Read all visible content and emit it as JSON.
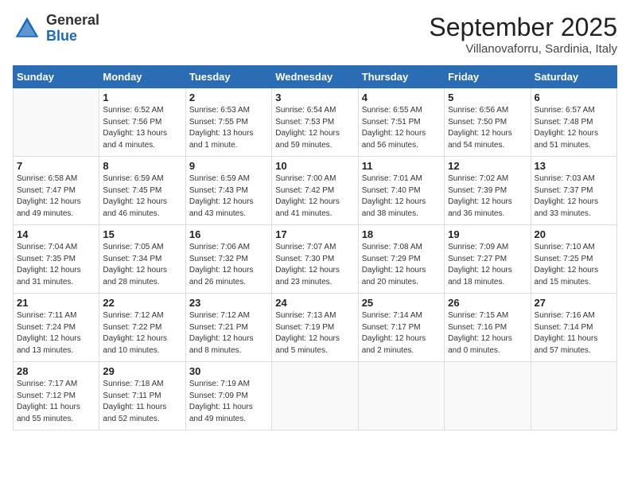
{
  "logo": {
    "general": "General",
    "blue": "Blue"
  },
  "title": "September 2025",
  "subtitle": "Villanovaforru, Sardinia, Italy",
  "days_of_week": [
    "Sunday",
    "Monday",
    "Tuesday",
    "Wednesday",
    "Thursday",
    "Friday",
    "Saturday"
  ],
  "weeks": [
    [
      {
        "day": "",
        "info": ""
      },
      {
        "day": "1",
        "info": "Sunrise: 6:52 AM\nSunset: 7:56 PM\nDaylight: 13 hours\nand 4 minutes."
      },
      {
        "day": "2",
        "info": "Sunrise: 6:53 AM\nSunset: 7:55 PM\nDaylight: 13 hours\nand 1 minute."
      },
      {
        "day": "3",
        "info": "Sunrise: 6:54 AM\nSunset: 7:53 PM\nDaylight: 12 hours\nand 59 minutes."
      },
      {
        "day": "4",
        "info": "Sunrise: 6:55 AM\nSunset: 7:51 PM\nDaylight: 12 hours\nand 56 minutes."
      },
      {
        "day": "5",
        "info": "Sunrise: 6:56 AM\nSunset: 7:50 PM\nDaylight: 12 hours\nand 54 minutes."
      },
      {
        "day": "6",
        "info": "Sunrise: 6:57 AM\nSunset: 7:48 PM\nDaylight: 12 hours\nand 51 minutes."
      }
    ],
    [
      {
        "day": "7",
        "info": "Sunrise: 6:58 AM\nSunset: 7:47 PM\nDaylight: 12 hours\nand 49 minutes."
      },
      {
        "day": "8",
        "info": "Sunrise: 6:59 AM\nSunset: 7:45 PM\nDaylight: 12 hours\nand 46 minutes."
      },
      {
        "day": "9",
        "info": "Sunrise: 6:59 AM\nSunset: 7:43 PM\nDaylight: 12 hours\nand 43 minutes."
      },
      {
        "day": "10",
        "info": "Sunrise: 7:00 AM\nSunset: 7:42 PM\nDaylight: 12 hours\nand 41 minutes."
      },
      {
        "day": "11",
        "info": "Sunrise: 7:01 AM\nSunset: 7:40 PM\nDaylight: 12 hours\nand 38 minutes."
      },
      {
        "day": "12",
        "info": "Sunrise: 7:02 AM\nSunset: 7:39 PM\nDaylight: 12 hours\nand 36 minutes."
      },
      {
        "day": "13",
        "info": "Sunrise: 7:03 AM\nSunset: 7:37 PM\nDaylight: 12 hours\nand 33 minutes."
      }
    ],
    [
      {
        "day": "14",
        "info": "Sunrise: 7:04 AM\nSunset: 7:35 PM\nDaylight: 12 hours\nand 31 minutes."
      },
      {
        "day": "15",
        "info": "Sunrise: 7:05 AM\nSunset: 7:34 PM\nDaylight: 12 hours\nand 28 minutes."
      },
      {
        "day": "16",
        "info": "Sunrise: 7:06 AM\nSunset: 7:32 PM\nDaylight: 12 hours\nand 26 minutes."
      },
      {
        "day": "17",
        "info": "Sunrise: 7:07 AM\nSunset: 7:30 PM\nDaylight: 12 hours\nand 23 minutes."
      },
      {
        "day": "18",
        "info": "Sunrise: 7:08 AM\nSunset: 7:29 PM\nDaylight: 12 hours\nand 20 minutes."
      },
      {
        "day": "19",
        "info": "Sunrise: 7:09 AM\nSunset: 7:27 PM\nDaylight: 12 hours\nand 18 minutes."
      },
      {
        "day": "20",
        "info": "Sunrise: 7:10 AM\nSunset: 7:25 PM\nDaylight: 12 hours\nand 15 minutes."
      }
    ],
    [
      {
        "day": "21",
        "info": "Sunrise: 7:11 AM\nSunset: 7:24 PM\nDaylight: 12 hours\nand 13 minutes."
      },
      {
        "day": "22",
        "info": "Sunrise: 7:12 AM\nSunset: 7:22 PM\nDaylight: 12 hours\nand 10 minutes."
      },
      {
        "day": "23",
        "info": "Sunrise: 7:12 AM\nSunset: 7:21 PM\nDaylight: 12 hours\nand 8 minutes."
      },
      {
        "day": "24",
        "info": "Sunrise: 7:13 AM\nSunset: 7:19 PM\nDaylight: 12 hours\nand 5 minutes."
      },
      {
        "day": "25",
        "info": "Sunrise: 7:14 AM\nSunset: 7:17 PM\nDaylight: 12 hours\nand 2 minutes."
      },
      {
        "day": "26",
        "info": "Sunrise: 7:15 AM\nSunset: 7:16 PM\nDaylight: 12 hours\nand 0 minutes."
      },
      {
        "day": "27",
        "info": "Sunrise: 7:16 AM\nSunset: 7:14 PM\nDaylight: 11 hours\nand 57 minutes."
      }
    ],
    [
      {
        "day": "28",
        "info": "Sunrise: 7:17 AM\nSunset: 7:12 PM\nDaylight: 11 hours\nand 55 minutes."
      },
      {
        "day": "29",
        "info": "Sunrise: 7:18 AM\nSunset: 7:11 PM\nDaylight: 11 hours\nand 52 minutes."
      },
      {
        "day": "30",
        "info": "Sunrise: 7:19 AM\nSunset: 7:09 PM\nDaylight: 11 hours\nand 49 minutes."
      },
      {
        "day": "",
        "info": ""
      },
      {
        "day": "",
        "info": ""
      },
      {
        "day": "",
        "info": ""
      },
      {
        "day": "",
        "info": ""
      }
    ]
  ]
}
